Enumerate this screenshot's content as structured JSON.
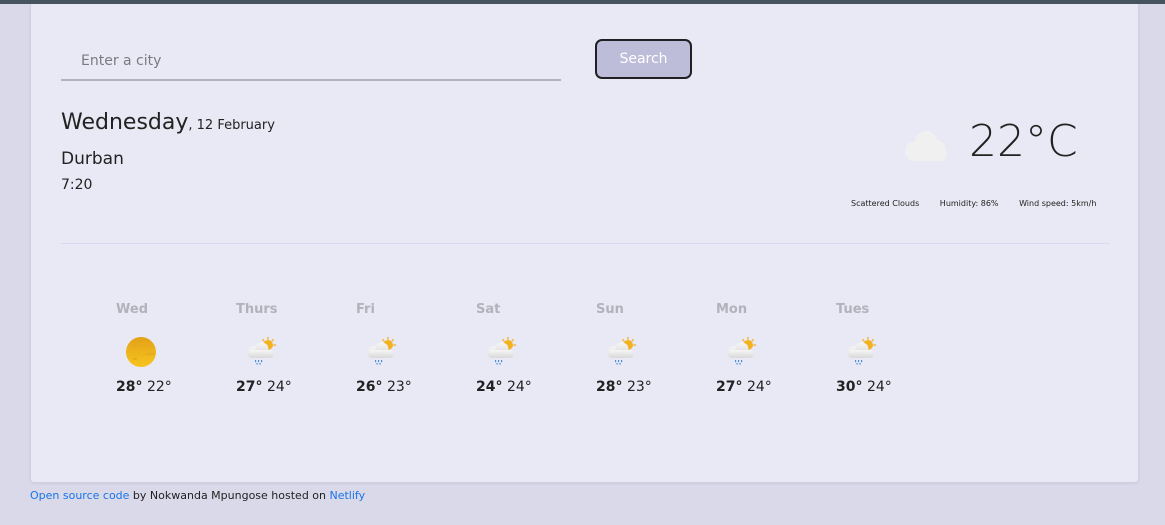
{
  "search": {
    "placeholder": "Enter a city",
    "value": "",
    "button_label": "Search"
  },
  "current": {
    "weekday": "Wednesday",
    "date": ", 12 February",
    "city": "Durban",
    "time": "7:20",
    "icon": "cloud-icon",
    "temperature": "22°C",
    "description": "Scattered Clouds",
    "humidity": "Humidity: 86%",
    "wind": "Wind speed: 5km/h"
  },
  "forecast": [
    {
      "day": "Wed",
      "icon": "sun-icon",
      "max": "28°",
      "min": "22°"
    },
    {
      "day": "Thurs",
      "icon": "rain-sun-cloud-icon",
      "max": "27°",
      "min": "24°"
    },
    {
      "day": "Fri",
      "icon": "rain-sun-cloud-icon",
      "max": "26°",
      "min": "23°"
    },
    {
      "day": "Sat",
      "icon": "rain-sun-cloud-icon",
      "max": "24°",
      "min": "24°"
    },
    {
      "day": "Sun",
      "icon": "rain-sun-cloud-icon",
      "max": "28°",
      "min": "23°"
    },
    {
      "day": "Mon",
      "icon": "rain-sun-cloud-icon",
      "max": "27°",
      "min": "24°"
    },
    {
      "day": "Tues",
      "icon": "rain-sun-cloud-icon",
      "max": "30°",
      "min": "24°"
    }
  ],
  "footer": {
    "source_link": "Open source code",
    "by_text": " by Nokwanda Mpungose hosted on ",
    "host_link": "Netlify"
  },
  "colors": {
    "accent_button": "#bdbcd9",
    "link": "#1a73e8",
    "day_label": "#b2b2bd"
  }
}
